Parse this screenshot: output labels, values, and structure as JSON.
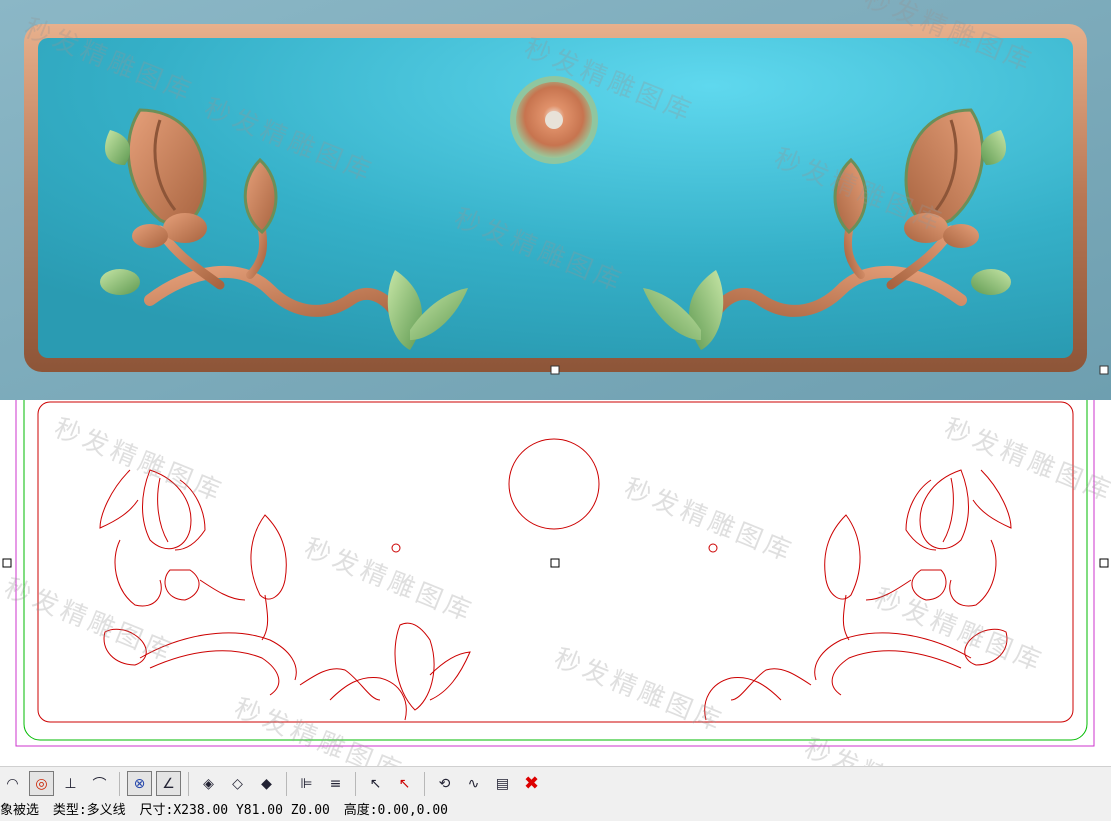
{
  "watermark_text": "秒发精雕图库",
  "status": {
    "selection": "对象被选",
    "type_label": "类型:",
    "type_value": "多义线",
    "size_label": "尺寸:",
    "size_value": "X238.00 Y81.00 Z0.00",
    "height_label": "高度:",
    "height_value": "0.00,0.00"
  },
  "colors": {
    "relief_background": "#3fb8d0",
    "relief_carving": "#c98a5e",
    "leaf_green": "#8ab86a",
    "vector_line": "#cc0000",
    "outline_green": "#00bb00",
    "selection_magenta": "#cc33cc"
  },
  "toolbar_icons": [
    "snap-arc-icon",
    "snap-center-icon",
    "snap-perpendicular-icon",
    "snap-tangent-icon",
    "snap-intersection-icon",
    "snap-angle-icon",
    "node-edit-icon",
    "node-add-icon",
    "node-delete-icon",
    "align-left-icon",
    "align-distribute-icon",
    "select-pointer-icon",
    "delete-pointer-icon",
    "transform-icon",
    "edit-curve-icon",
    "layer-icon",
    "delete-icon"
  ]
}
